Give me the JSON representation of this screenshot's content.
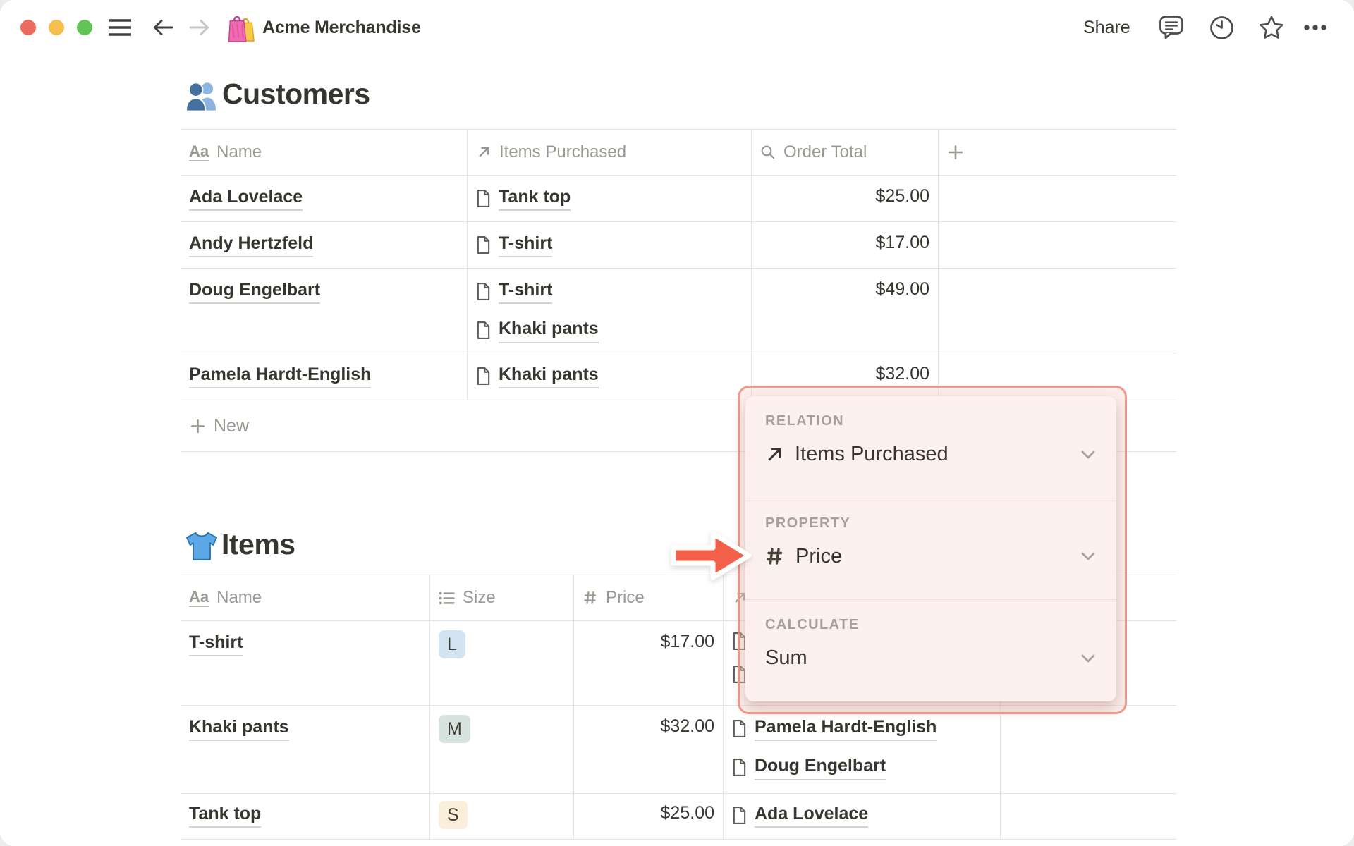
{
  "window": {
    "title": "Acme Merchandise",
    "title_icon": "shopping-bags-emoji",
    "share_label": "Share",
    "titlebar_icons": [
      "hamburger-icon",
      "back-icon",
      "forward-icon",
      "comment-icon",
      "history-icon",
      "star-icon",
      "ellipsis-icon"
    ]
  },
  "customers": {
    "heading": "Customers",
    "heading_icon": "busts-in-silhouette-emoji",
    "columns": [
      {
        "icon": "title-icon",
        "label": "Name"
      },
      {
        "icon": "arrow-up-right-icon",
        "label": "Items Purchased"
      },
      {
        "icon": "magnifier-icon",
        "label": "Order Total"
      },
      {
        "icon": "plus-icon",
        "label": ""
      }
    ],
    "rows": [
      {
        "name": "Ada Lovelace",
        "items": [
          "Tank top"
        ],
        "order_total": "$25.00"
      },
      {
        "name": "Andy Hertzfeld",
        "items": [
          "T-shirt"
        ],
        "order_total": "$17.00"
      },
      {
        "name": "Doug Engelbart",
        "items": [
          "T-shirt",
          "Khaki pants"
        ],
        "order_total": "$49.00"
      },
      {
        "name": "Pamela Hardt-English",
        "items": [
          "Khaki pants"
        ],
        "order_total": "$32.00"
      }
    ],
    "new_row_label": "New"
  },
  "items": {
    "heading": "Items",
    "heading_icon": "tshirt-emoji",
    "columns": [
      {
        "icon": "title-icon",
        "label": "Name"
      },
      {
        "icon": "list-icon",
        "label": "Size"
      },
      {
        "icon": "hash-icon",
        "label": "Price"
      },
      {
        "icon": "arrow-up-right-icon",
        "label": ""
      }
    ],
    "rows": [
      {
        "name": "T-shirt",
        "size": "L",
        "size_color": "#d4e3f2",
        "price": "$17.00",
        "customers": [
          "",
          ""
        ]
      },
      {
        "name": "Khaki pants",
        "size": "M",
        "size_color": "#d7e3df",
        "price": "$32.00",
        "customers": [
          "Pamela Hardt-English",
          "Doug Engelbart"
        ]
      },
      {
        "name": "Tank top",
        "size": "S",
        "size_color": "#fbeeda",
        "price": "$25.00",
        "customers": [
          "Ada Lovelace"
        ]
      }
    ]
  },
  "popup": {
    "sections": [
      {
        "label": "RELATION",
        "icon": "arrow-up-right-icon",
        "value": "Items Purchased"
      },
      {
        "label": "PROPERTY",
        "icon": "hash-icon",
        "value": "Price"
      },
      {
        "label": "CALCULATE",
        "icon": null,
        "value": "Sum"
      }
    ]
  },
  "colors": {
    "accent_arrow": "#f2604a",
    "popup_bg": "#fdf1ef",
    "popup_border": "#f0998c",
    "popup_halo": "rgba(250,215,209,0.40)",
    "tag_blue": "#d4e3f2",
    "tag_green": "#d7e3df",
    "tag_yellow": "#fbeeda",
    "traffic_red": "#ed6a5e",
    "traffic_yellow": "#f5bf4f",
    "traffic_green": "#61c454",
    "table_border": "#e5e4e1",
    "text_dark": "#37352f",
    "text_gray": "#9b9892"
  }
}
